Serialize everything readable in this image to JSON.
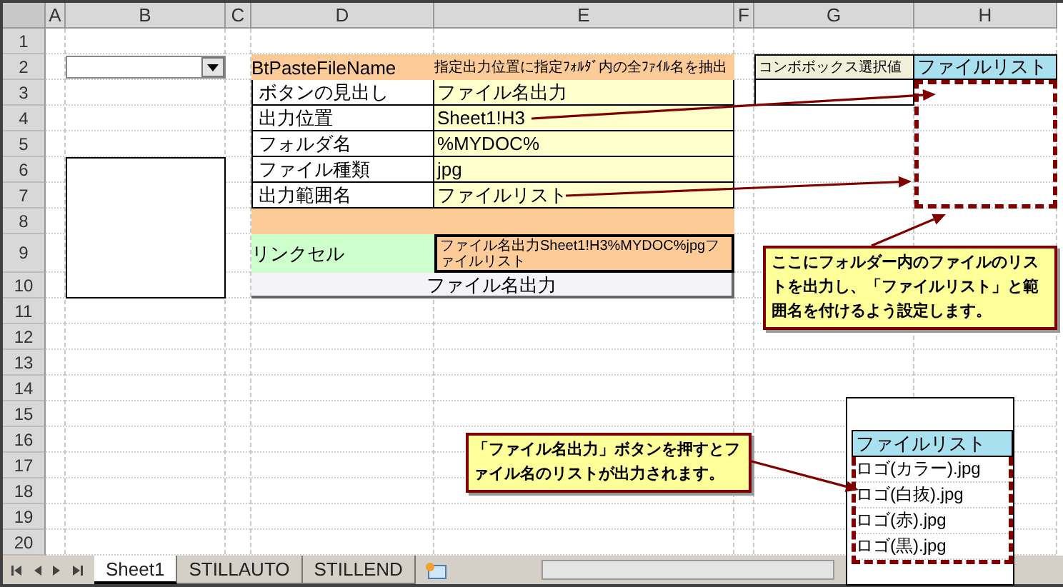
{
  "columns": [
    "A",
    "B",
    "C",
    "D",
    "E",
    "F",
    "G",
    "H"
  ],
  "rows": [
    "1",
    "2",
    "3",
    "4",
    "5",
    "6",
    "7",
    "8",
    "9",
    "10",
    "11",
    "12",
    "13",
    "14",
    "15",
    "16",
    "17",
    "18",
    "19",
    "20"
  ],
  "settings": {
    "title": "BtPasteFileName",
    "note": "指定出力位置に指定ﾌｫﾙﾀﾞ内の全ﾌｧｲﾙ名を抽出",
    "rows": [
      {
        "label": "ボタンの見出し",
        "value": "ファイル名出力"
      },
      {
        "label": "出力位置",
        "value": "Sheet1!H3"
      },
      {
        "label": "フォルダ名",
        "value": "%MYDOC%"
      },
      {
        "label": "ファイル種類",
        "value": "jpg"
      },
      {
        "label": "出力範囲名",
        "value": "ファイルリスト"
      }
    ],
    "link_label": "リンクセル",
    "link_value": "ファイル名出力Sheet1!H3%MYDOC%jpgファイルリスト",
    "button": "ファイル名出力"
  },
  "output": {
    "label": "コンボボックス選択値",
    "header": "ファイルリスト"
  },
  "callouts": [
    "ここにフォルダー内のファイルのリストを出力し、「ファイルリスト」と範囲名を付けるよう設定します。",
    "「ファイル名出力」ボタンを押すとファイル名のリストが出力されます。"
  ],
  "inset": {
    "header": "ファイルリスト",
    "items": [
      "ロゴ(カラー).jpg",
      "ロゴ(白抜).jpg",
      "ロゴ(赤).jpg",
      "ロゴ(黒).jpg"
    ]
  },
  "sheet_tabs": [
    {
      "label": "Sheet1",
      "selected": true
    },
    {
      "label": "STILLAUTO",
      "selected": false
    },
    {
      "label": "STILLEND",
      "selected": false
    }
  ]
}
